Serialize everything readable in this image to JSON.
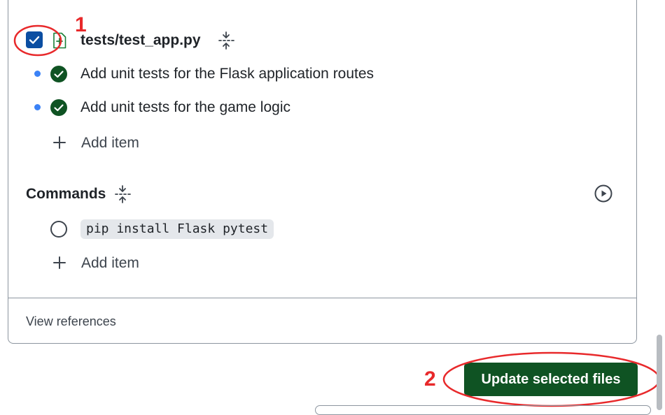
{
  "file": {
    "path": "tests/test_app.py",
    "checked": true,
    "items": [
      {
        "text": "Add unit tests for the Flask application routes",
        "done": true
      },
      {
        "text": "Add unit tests for the game logic",
        "done": true
      }
    ],
    "add_item_label": "Add item"
  },
  "commands": {
    "title": "Commands",
    "items": [
      {
        "text": "pip install Flask pytest",
        "done": false
      }
    ],
    "add_item_label": "Add item"
  },
  "footer": {
    "view_references_label": "View references"
  },
  "actions": {
    "update_button_label": "Update selected files"
  },
  "annotations": {
    "marker_1": "1",
    "marker_2": "2"
  },
  "colors": {
    "primary_button": "#0f5323",
    "checkbox": "#0b4ea2",
    "done_check": "#0f5323",
    "bullet_dot": "#3b82f6",
    "annotation": "#e8292b"
  },
  "icons": {
    "file_added": "file-plus-icon",
    "collapse": "fold-icon",
    "run": "play-circle-icon",
    "done": "check-circle-icon",
    "pending": "circle-icon",
    "add": "plus-icon"
  }
}
